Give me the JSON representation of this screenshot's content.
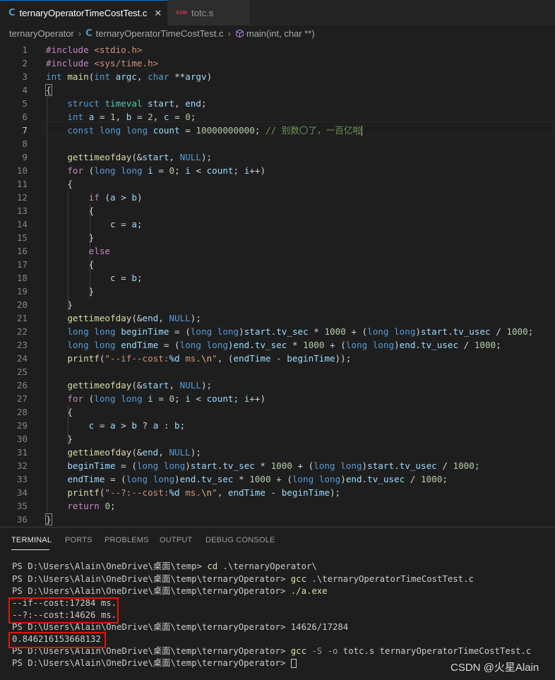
{
  "tabs": [
    {
      "icon_text": "C",
      "label": "ternaryOperatorTimeCostTest.c",
      "close": "✕"
    },
    {
      "icon_text": "ASM",
      "label": "totc.s"
    }
  ],
  "breadcrumb": {
    "folder": "ternaryOperator",
    "file": "ternaryOperatorTimeCostTest.c",
    "symbol": "main(int, char **)"
  },
  "editor": {
    "current_line": 7
  },
  "panel": {
    "tabs": [
      "TERMINAL",
      "PORTS",
      "PROBLEMS",
      "OUTPUT",
      "DEBUG CONSOLE"
    ],
    "active_tab": "TERMINAL"
  },
  "terminal": {
    "lines": [
      {
        "prompt": "PS D:\\Users\\Alain\\OneDrive\\桌面\\temp> ",
        "cmd": "cd",
        "args": " .\\ternaryOperator\\"
      },
      {
        "prompt": "PS D:\\Users\\Alain\\OneDrive\\桌面\\temp\\ternaryOperator> ",
        "cmd": "gcc",
        "args": " .\\ternaryOperatorTimeCostTest.c"
      },
      {
        "prompt": "PS D:\\Users\\Alain\\OneDrive\\桌面\\temp\\ternaryOperator> ",
        "cmd": "./a.exe",
        "args": ""
      },
      {
        "text": "--if--cost:17284 ms."
      },
      {
        "text": "--?:--cost:14626 ms."
      },
      {
        "prompt": "PS D:\\Users\\Alain\\OneDrive\\桌面\\temp\\ternaryOperator> ",
        "cmd": "",
        "args": "14626/17284"
      },
      {
        "text": "0.846216153668132"
      },
      {
        "prompt": "PS D:\\Users\\Alain\\OneDrive\\桌面\\temp\\ternaryOperator> ",
        "cmd": "gcc",
        "flags": " -S -o",
        "args": " totc.s ternaryOperatorTimeCostTest.c"
      },
      {
        "prompt": "PS D:\\Users\\Alain\\OneDrive\\桌面\\temp\\ternaryOperator> ",
        "cmd": "",
        "args": ""
      }
    ]
  },
  "watermark": "CSDN @火星Alain",
  "colors": {
    "keyword": "#569cd6",
    "function": "#dcdcaa",
    "variable": "#9cdcfe",
    "number": "#b5cea8",
    "string": "#ce9178",
    "comment": "#6a9955",
    "type": "#4ec9b0",
    "control": "#c586c0",
    "highlight_box": "#e51400"
  },
  "code_lines": [
    [
      [
        "p",
        "#include"
      ],
      [
        "",
        ""
      ],
      [
        "s",
        " <stdio.h>"
      ]
    ],
    [
      [
        "p",
        "#include"
      ],
      [
        "s",
        " <sys/time.h>"
      ]
    ],
    [
      [
        "k",
        "int"
      ],
      [
        "",
        " "
      ],
      [
        "f",
        "main"
      ],
      [
        "",
        "("
      ],
      [
        "k",
        "int"
      ],
      [
        "",
        " "
      ],
      [
        "v",
        "argc"
      ],
      [
        "",
        ", "
      ],
      [
        "k",
        "char"
      ],
      [
        "",
        " **"
      ],
      [
        "v",
        "argv"
      ],
      [
        "",
        ")"
      ]
    ],
    [
      [
        "",
        "{"
      ]
    ],
    [
      [
        "",
        "    "
      ],
      [
        "k",
        "struct"
      ],
      [
        "",
        " "
      ],
      [
        "t",
        "timeval"
      ],
      [
        "",
        " "
      ],
      [
        "v",
        "start"
      ],
      [
        "",
        ", "
      ],
      [
        "v",
        "end"
      ],
      [
        "",
        ";"
      ]
    ],
    [
      [
        "",
        "    "
      ],
      [
        "k",
        "int"
      ],
      [
        "",
        " "
      ],
      [
        "v",
        "a"
      ],
      [
        "",
        " = "
      ],
      [
        "n",
        "1"
      ],
      [
        "",
        ", "
      ],
      [
        "v",
        "b"
      ],
      [
        "",
        " = "
      ],
      [
        "n",
        "2"
      ],
      [
        "",
        ", "
      ],
      [
        "v",
        "c"
      ],
      [
        "",
        " = "
      ],
      [
        "n",
        "0"
      ],
      [
        "",
        ";"
      ]
    ],
    [
      [
        "",
        "    "
      ],
      [
        "k",
        "const"
      ],
      [
        "",
        " "
      ],
      [
        "k",
        "long"
      ],
      [
        "",
        " "
      ],
      [
        "k",
        "long"
      ],
      [
        "",
        " "
      ],
      [
        "v",
        "count"
      ],
      [
        "",
        " = "
      ],
      [
        "n",
        "10000000000"
      ],
      [
        "",
        "; "
      ],
      [
        "cm",
        "// 别数〇了，一百亿啦"
      ]
    ],
    [],
    [
      [
        "",
        "    "
      ],
      [
        "f",
        "gettimeofday"
      ],
      [
        "",
        "(&"
      ],
      [
        "v",
        "start"
      ],
      [
        "",
        ", "
      ],
      [
        "k",
        "NULL"
      ],
      [
        "",
        ");"
      ]
    ],
    [
      [
        "",
        "    "
      ],
      [
        "p",
        "for"
      ],
      [
        "",
        " ("
      ],
      [
        "k",
        "long"
      ],
      [
        "",
        " "
      ],
      [
        "k",
        "long"
      ],
      [
        "",
        " "
      ],
      [
        "v",
        "i"
      ],
      [
        "",
        " = "
      ],
      [
        "n",
        "0"
      ],
      [
        "",
        "; "
      ],
      [
        "v",
        "i"
      ],
      [
        "",
        " < "
      ],
      [
        "v",
        "count"
      ],
      [
        "",
        "; "
      ],
      [
        "v",
        "i"
      ],
      [
        "",
        "++)"
      ]
    ],
    [
      [
        "",
        "    {"
      ]
    ],
    [
      [
        "",
        "        "
      ],
      [
        "p",
        "if"
      ],
      [
        "",
        " ("
      ],
      [
        "v",
        "a"
      ],
      [
        "",
        " > "
      ],
      [
        "v",
        "b"
      ],
      [
        "",
        ")"
      ]
    ],
    [
      [
        "",
        "        {"
      ]
    ],
    [
      [
        "",
        "            "
      ],
      [
        "v",
        "c"
      ],
      [
        "",
        " = "
      ],
      [
        "v",
        "a"
      ],
      [
        "",
        ";"
      ]
    ],
    [
      [
        "",
        "        }"
      ]
    ],
    [
      [
        "",
        "        "
      ],
      [
        "p",
        "else"
      ]
    ],
    [
      [
        "",
        "        {"
      ]
    ],
    [
      [
        "",
        "            "
      ],
      [
        "v",
        "c"
      ],
      [
        "",
        " = "
      ],
      [
        "v",
        "b"
      ],
      [
        "",
        ";"
      ]
    ],
    [
      [
        "",
        "        }"
      ]
    ],
    [
      [
        "",
        "    }"
      ]
    ],
    [
      [
        "",
        "    "
      ],
      [
        "f",
        "gettimeofday"
      ],
      [
        "",
        "(&"
      ],
      [
        "v",
        "end"
      ],
      [
        "",
        ", "
      ],
      [
        "k",
        "NULL"
      ],
      [
        "",
        ");"
      ]
    ],
    [
      [
        "",
        "    "
      ],
      [
        "k",
        "long"
      ],
      [
        "",
        " "
      ],
      [
        "k",
        "long"
      ],
      [
        "",
        " "
      ],
      [
        "v",
        "beginTime"
      ],
      [
        "",
        " = ("
      ],
      [
        "k",
        "long"
      ],
      [
        "",
        " "
      ],
      [
        "k",
        "long"
      ],
      [
        "",
        ")"
      ],
      [
        "v",
        "start"
      ],
      [
        "",
        "."
      ],
      [
        "v",
        "tv_sec"
      ],
      [
        "",
        " * "
      ],
      [
        "n",
        "1000"
      ],
      [
        "",
        " + ("
      ],
      [
        "k",
        "long"
      ],
      [
        "",
        " "
      ],
      [
        "k",
        "long"
      ],
      [
        "",
        ")"
      ],
      [
        "v",
        "start"
      ],
      [
        "",
        "."
      ],
      [
        "v",
        "tv_usec"
      ],
      [
        "",
        " / "
      ],
      [
        "n",
        "1000"
      ],
      [
        "",
        ";"
      ]
    ],
    [
      [
        "",
        "    "
      ],
      [
        "k",
        "long"
      ],
      [
        "",
        " "
      ],
      [
        "k",
        "long"
      ],
      [
        "",
        " "
      ],
      [
        "v",
        "endTime"
      ],
      [
        "",
        " = ("
      ],
      [
        "k",
        "long"
      ],
      [
        "",
        " "
      ],
      [
        "k",
        "long"
      ],
      [
        "",
        ")"
      ],
      [
        "v",
        "end"
      ],
      [
        "",
        "."
      ],
      [
        "v",
        "tv_sec"
      ],
      [
        "",
        " * "
      ],
      [
        "n",
        "1000"
      ],
      [
        "",
        " + ("
      ],
      [
        "k",
        "long"
      ],
      [
        "",
        " "
      ],
      [
        "k",
        "long"
      ],
      [
        "",
        ")"
      ],
      [
        "v",
        "end"
      ],
      [
        "",
        "."
      ],
      [
        "v",
        "tv_usec"
      ],
      [
        "",
        " / "
      ],
      [
        "n",
        "1000"
      ],
      [
        "",
        ";"
      ]
    ],
    [
      [
        "",
        "    "
      ],
      [
        "f",
        "printf"
      ],
      [
        "",
        "("
      ],
      [
        "s",
        "\"--if--cost:"
      ],
      [
        "v",
        "%d"
      ],
      [
        "s",
        " ms."
      ],
      [
        "e",
        "\\n"
      ],
      [
        "s",
        "\""
      ],
      [
        "",
        ", ("
      ],
      [
        "v",
        "endTime"
      ],
      [
        "",
        " - "
      ],
      [
        "v",
        "beginTime"
      ],
      [
        "",
        "));"
      ]
    ],
    [],
    [
      [
        "",
        "    "
      ],
      [
        "f",
        "gettimeofday"
      ],
      [
        "",
        "(&"
      ],
      [
        "v",
        "start"
      ],
      [
        "",
        ", "
      ],
      [
        "k",
        "NULL"
      ],
      [
        "",
        ");"
      ]
    ],
    [
      [
        "",
        "    "
      ],
      [
        "p",
        "for"
      ],
      [
        "",
        " ("
      ],
      [
        "k",
        "long"
      ],
      [
        "",
        " "
      ],
      [
        "k",
        "long"
      ],
      [
        "",
        " "
      ],
      [
        "v",
        "i"
      ],
      [
        "",
        " = "
      ],
      [
        "n",
        "0"
      ],
      [
        "",
        "; "
      ],
      [
        "v",
        "i"
      ],
      [
        "",
        " < "
      ],
      [
        "v",
        "count"
      ],
      [
        "",
        "; "
      ],
      [
        "v",
        "i"
      ],
      [
        "",
        "++)"
      ]
    ],
    [
      [
        "",
        "    {"
      ]
    ],
    [
      [
        "",
        "        "
      ],
      [
        "v",
        "c"
      ],
      [
        "",
        " = "
      ],
      [
        "v",
        "a"
      ],
      [
        "",
        " > "
      ],
      [
        "v",
        "b"
      ],
      [
        "",
        " ? "
      ],
      [
        "v",
        "a"
      ],
      [
        "",
        " : "
      ],
      [
        "v",
        "b"
      ],
      [
        "",
        ";"
      ]
    ],
    [
      [
        "",
        "    }"
      ]
    ],
    [
      [
        "",
        "    "
      ],
      [
        "f",
        "gettimeofday"
      ],
      [
        "",
        "(&"
      ],
      [
        "v",
        "end"
      ],
      [
        "",
        ", "
      ],
      [
        "k",
        "NULL"
      ],
      [
        "",
        ");"
      ]
    ],
    [
      [
        "",
        "    "
      ],
      [
        "v",
        "beginTime"
      ],
      [
        "",
        " = ("
      ],
      [
        "k",
        "long"
      ],
      [
        "",
        " "
      ],
      [
        "k",
        "long"
      ],
      [
        "",
        ")"
      ],
      [
        "v",
        "start"
      ],
      [
        "",
        "."
      ],
      [
        "v",
        "tv_sec"
      ],
      [
        "",
        " * "
      ],
      [
        "n",
        "1000"
      ],
      [
        "",
        " + ("
      ],
      [
        "k",
        "long"
      ],
      [
        "",
        " "
      ],
      [
        "k",
        "long"
      ],
      [
        "",
        ")"
      ],
      [
        "v",
        "start"
      ],
      [
        "",
        "."
      ],
      [
        "v",
        "tv_usec"
      ],
      [
        "",
        " / "
      ],
      [
        "n",
        "1000"
      ],
      [
        "",
        ";"
      ]
    ],
    [
      [
        "",
        "    "
      ],
      [
        "v",
        "endTime"
      ],
      [
        "",
        " = ("
      ],
      [
        "k",
        "long"
      ],
      [
        "",
        " "
      ],
      [
        "k",
        "long"
      ],
      [
        "",
        ")"
      ],
      [
        "v",
        "end"
      ],
      [
        "",
        "."
      ],
      [
        "v",
        "tv_sec"
      ],
      [
        "",
        " * "
      ],
      [
        "n",
        "1000"
      ],
      [
        "",
        " + ("
      ],
      [
        "k",
        "long"
      ],
      [
        "",
        " "
      ],
      [
        "k",
        "long"
      ],
      [
        "",
        ")"
      ],
      [
        "v",
        "end"
      ],
      [
        "",
        "."
      ],
      [
        "v",
        "tv_usec"
      ],
      [
        "",
        " / "
      ],
      [
        "n",
        "1000"
      ],
      [
        "",
        ";"
      ]
    ],
    [
      [
        "",
        "    "
      ],
      [
        "f",
        "printf"
      ],
      [
        "",
        "("
      ],
      [
        "s",
        "\"--?:--cost:"
      ],
      [
        "v",
        "%d"
      ],
      [
        "s",
        " ms."
      ],
      [
        "e",
        "\\n"
      ],
      [
        "s",
        "\""
      ],
      [
        "",
        ", "
      ],
      [
        "v",
        "endTime"
      ],
      [
        "",
        " - "
      ],
      [
        "v",
        "beginTime"
      ],
      [
        "",
        ");"
      ]
    ],
    [
      [
        "",
        "    "
      ],
      [
        "p",
        "return"
      ],
      [
        "",
        " "
      ],
      [
        "n",
        "0"
      ],
      [
        "",
        ";"
      ]
    ],
    [
      [
        "",
        "}"
      ]
    ]
  ]
}
